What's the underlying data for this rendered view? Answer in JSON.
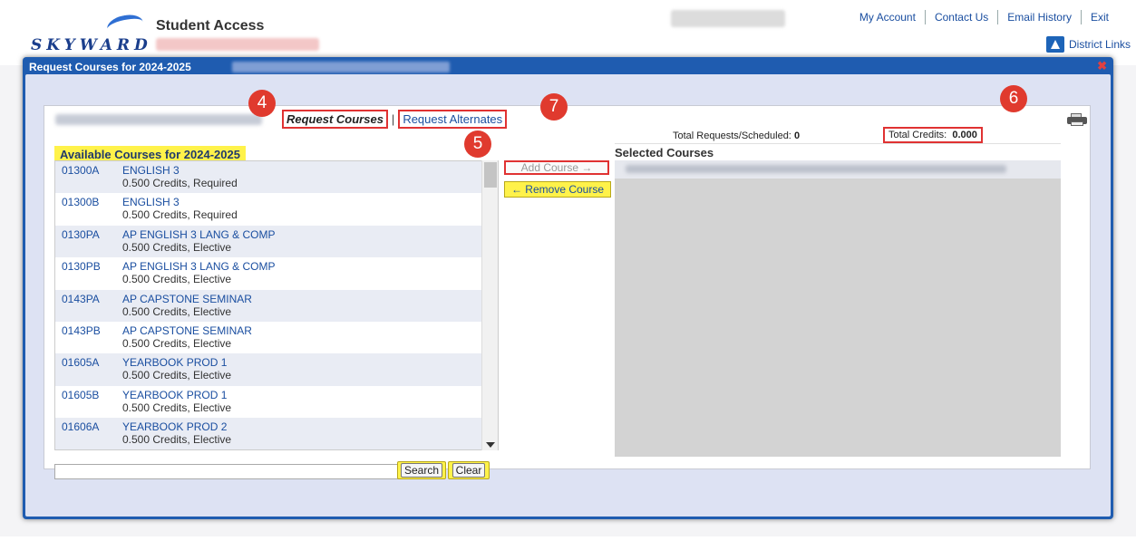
{
  "header": {
    "logo_text": "SKYWARD",
    "app_title": "Student Access",
    "links": [
      "My Account",
      "Contact Us",
      "Email History",
      "Exit"
    ],
    "district_links": "District Links"
  },
  "modal": {
    "title": "Request Courses for 2024-2025",
    "close_icon": "close-icon",
    "tabs": {
      "active": "Request Courses",
      "separator": "|",
      "alternates": "Request Alternates"
    },
    "totals": {
      "requests_label": "Total Requests/Scheduled:",
      "requests_value": "0",
      "credits_label": "Total Credits:",
      "credits_value": "0.000"
    },
    "available_heading": "Available Courses for 2024-2025",
    "selected_heading": "Selected Courses",
    "add_button": "Add Course →",
    "remove_button": "← Remove Course",
    "search_button": "Search",
    "clear_button": "Clear",
    "search_value": "",
    "courses": [
      {
        "code": "01300A",
        "name": "ENGLISH 3",
        "meta": "0.500 Credits,  Required"
      },
      {
        "code": "01300B",
        "name": "ENGLISH 3",
        "meta": "0.500 Credits,  Required"
      },
      {
        "code": "0130PA",
        "name": "AP ENGLISH 3 LANG & COMP",
        "meta": "0.500 Credits,  Elective"
      },
      {
        "code": "0130PB",
        "name": "AP ENGLISH 3 LANG & COMP",
        "meta": "0.500 Credits,  Elective"
      },
      {
        "code": "0143PA",
        "name": "AP CAPSTONE SEMINAR",
        "meta": "0.500 Credits,  Elective"
      },
      {
        "code": "0143PB",
        "name": "AP CAPSTONE SEMINAR",
        "meta": "0.500 Credits,  Elective"
      },
      {
        "code": "01605A",
        "name": "YEARBOOK PROD 1",
        "meta": "0.500 Credits,  Elective"
      },
      {
        "code": "01605B",
        "name": "YEARBOOK PROD 1",
        "meta": "0.500 Credits,  Elective"
      },
      {
        "code": "01606A",
        "name": "YEARBOOK PROD 2",
        "meta": "0.500 Credits,  Elective"
      }
    ]
  },
  "annotations": [
    "4",
    "5",
    "6",
    "7"
  ],
  "colors": {
    "modal_blue": "#1f5cb0",
    "highlight_yellow": "#fff24a",
    "annotation_red": "#e03a2e",
    "link_blue": "#1a4ea0"
  }
}
